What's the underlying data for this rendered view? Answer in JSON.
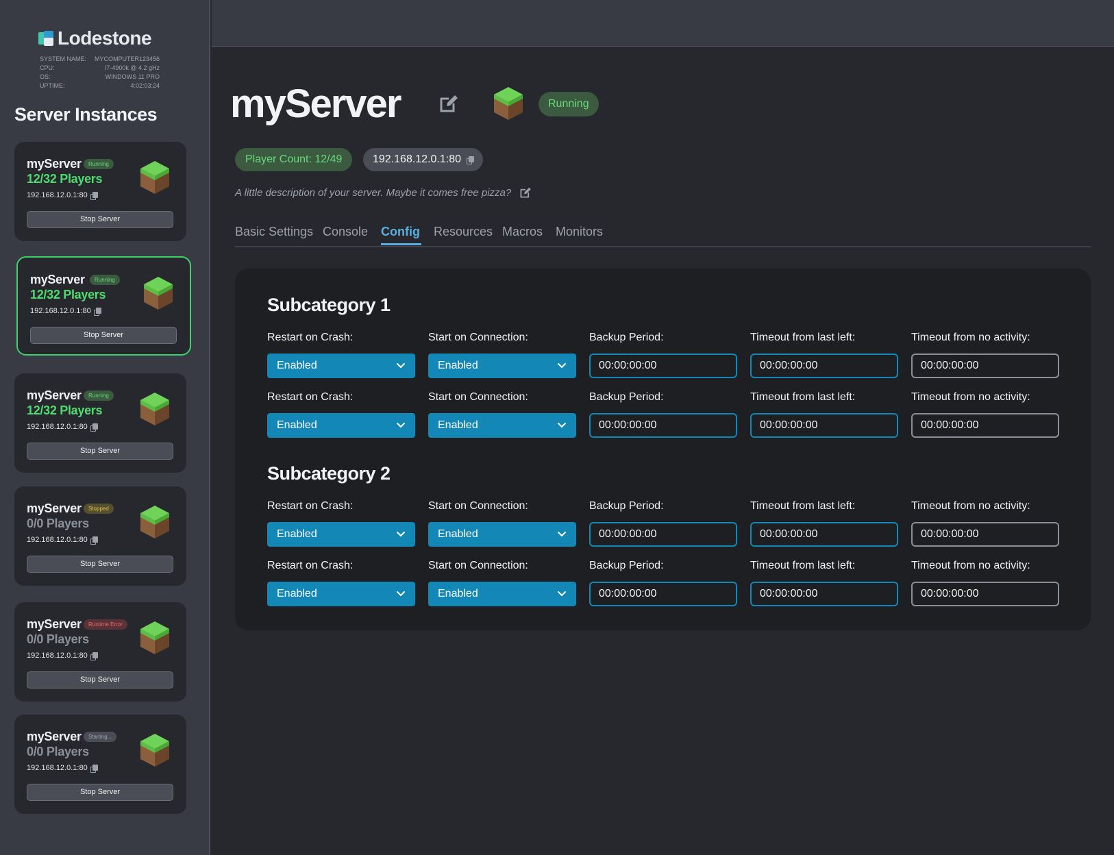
{
  "app": {
    "name": "Lodestone"
  },
  "system": {
    "rows": [
      {
        "label": "SYSTEM NAME:",
        "value": "MYCOMPUTER123456"
      },
      {
        "label": "CPU:",
        "value": "I7-4900k @ 4.2 gHz"
      },
      {
        "label": "OS:",
        "value": "WINDOWS 11 PRO"
      },
      {
        "label": "UPTIME:",
        "value": "4:02:03:24"
      }
    ]
  },
  "sidebar": {
    "title": "Server Instances",
    "instances": [
      {
        "name": "myServer",
        "status": "Running",
        "players": "12/32 Players",
        "address": "192.168.12.0.1:80",
        "button": "Stop Server"
      },
      {
        "name": "myServer",
        "status": "Running",
        "players": "12/32 Players",
        "address": "192.168.12.0.1:80",
        "button": "Stop Server"
      },
      {
        "name": "myServer",
        "status": "Running",
        "players": "12/32 Players",
        "address": "192.168.12.0.1:80",
        "button": "Stop Server"
      },
      {
        "name": "myServer",
        "status": "Stopped",
        "players": "0/0 Players",
        "address": "192.168.12.0.1:80",
        "button": "Stop Server"
      },
      {
        "name": "myServer",
        "status": "Runtime Error",
        "players": "0/0 Players",
        "address": "192.168.12.0.1:80",
        "button": "Stop Server"
      },
      {
        "name": "myServer",
        "status": "Starting...",
        "players": "0/0 Players",
        "address": "192.168.12.0.1:80",
        "button": "Stop Server"
      }
    ]
  },
  "server": {
    "name": "myServer",
    "status": "Running",
    "player_count": "Player Count: 12/49",
    "address": "192.168.12.0.1:80",
    "description": "A little description of your server. Maybe it comes free pizza?"
  },
  "tabs": [
    "Basic Settings",
    "Console",
    "Config",
    "Resources",
    "Macros",
    "Monitors"
  ],
  "active_tab": "Config",
  "config": {
    "subcategories": [
      {
        "title": "Subcategory 1",
        "rows": [
          {
            "restart_label": "Restart on Crash:",
            "restart_value": "Enabled",
            "start_label": "Start on Connection:",
            "start_value": "Enabled",
            "backup_label": "Backup Period:",
            "backup_value": "00:00:00:00",
            "last_left_label": "Timeout from last left:",
            "last_left_value": "00:00:00:00",
            "no_activity_label": "Timeout from no activity:",
            "no_activity_value": "00:00:00:00"
          },
          {
            "restart_label": "Restart on Crash:",
            "restart_value": "Enabled",
            "start_label": "Start on Connection:",
            "start_value": "Enabled",
            "backup_label": "Backup Period:",
            "backup_value": "00:00:00:00",
            "last_left_label": "Timeout from last left:",
            "last_left_value": "00:00:00:00",
            "no_activity_label": "Timeout from no activity:",
            "no_activity_value": "00:00:00:00"
          }
        ]
      },
      {
        "title": "Subcategory 2",
        "rows": [
          {
            "restart_label": "Restart on Crash:",
            "restart_value": "Enabled",
            "start_label": "Start on Connection:",
            "start_value": "Enabled",
            "backup_label": "Backup Period:",
            "backup_value": "00:00:00:00",
            "last_left_label": "Timeout from last left:",
            "last_left_value": "00:00:00:00",
            "no_activity_label": "Timeout from no activity:",
            "no_activity_value": "00:00:00:00"
          },
          {
            "restart_label": "Restart on Crash:",
            "restart_value": "Enabled",
            "start_label": "Start on Connection:",
            "start_value": "Enabled",
            "backup_label": "Backup Period:",
            "backup_value": "00:00:00:00",
            "last_left_label": "Timeout from last left:",
            "last_left_value": "00:00:00:00",
            "no_activity_label": "Timeout from no activity:",
            "no_activity_value": "00:00:00:00"
          }
        ]
      }
    ]
  },
  "colors": {
    "accent_blue": "#1387b6",
    "running_green": "#4fdc6f",
    "active_tab": "#5aaee2",
    "selected_border": "#3bd26b"
  },
  "icons": [
    "grass-block-icon",
    "copy-icon",
    "edit-icon",
    "chevron-down-icon"
  ]
}
